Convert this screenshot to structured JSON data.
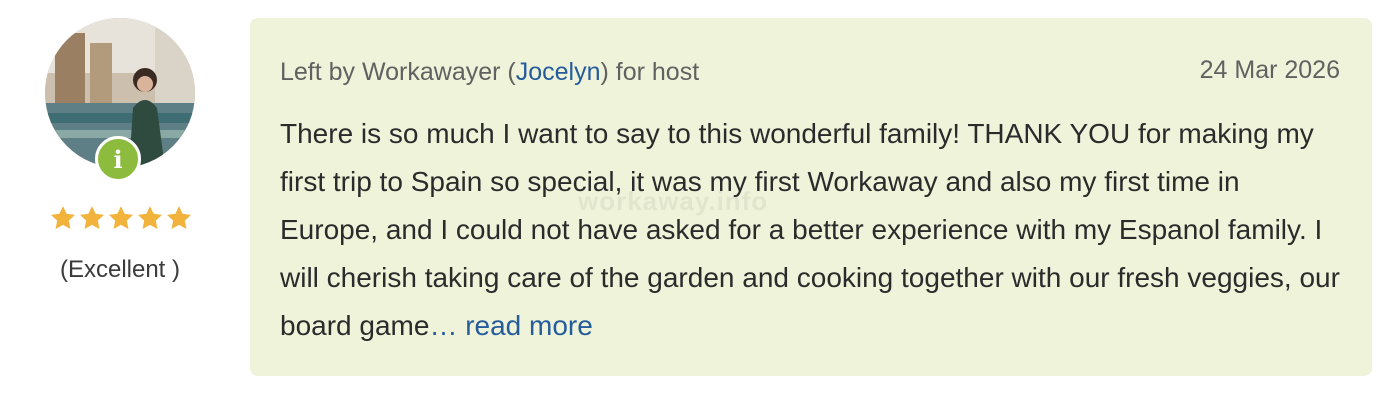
{
  "reviewer": {
    "rating_stars": 5,
    "rating_label": "(Excellent )",
    "star_color": "#f2b33d",
    "badge_icon": "info-icon",
    "badge_color": "#8dbb3d"
  },
  "review": {
    "meta_prefix": "Left by Workawayer (",
    "reviewer_name": "Jocelyn",
    "meta_suffix": ") for host",
    "date": "24 Mar 2026",
    "text": "There is so much I want to say to this wonderful family! THANK YOU for making my first trip to Spain so special, it was my first Workaway and also my first time in Europe, and I could not have asked for a better experience with my Espanol family. I will cherish taking care of the garden and cooking together with our fresh veggies, our board game",
    "ellipsis": "…",
    "read_more": " read more",
    "watermark": "workaway.info",
    "link_color": "#245c9c",
    "card_color": "#eff3da"
  }
}
